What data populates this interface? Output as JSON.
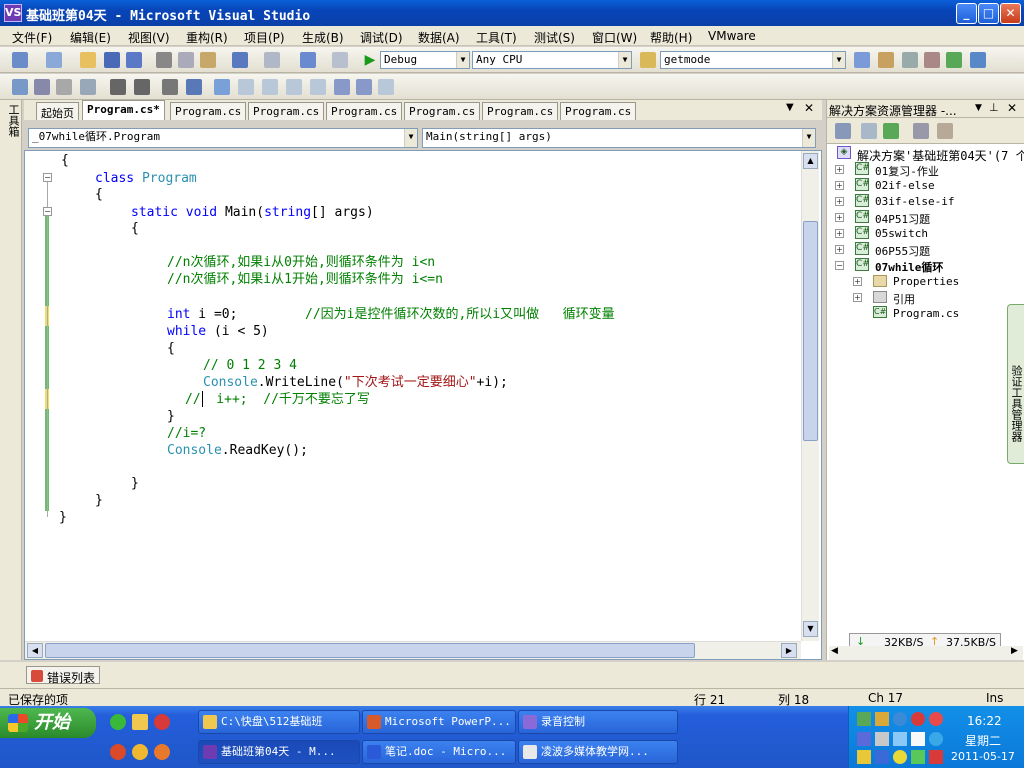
{
  "window": {
    "title": "基础班第04天 - Microsoft Visual Studio",
    "icon_glyph": "VS",
    "buttons": {
      "minimize": "_",
      "maximize": "□",
      "close": "✕"
    }
  },
  "menu": [
    "文件(F)",
    "编辑(E)",
    "视图(V)",
    "重构(R)",
    "项目(P)",
    "生成(B)",
    "调试(D)",
    "数据(A)",
    "工具(T)",
    "测试(S)",
    "窗口(W)",
    "帮助(H)",
    "VMware"
  ],
  "toolbar": {
    "config": "Debug",
    "platform": "Any CPU",
    "find": "getmode"
  },
  "toolbox_label": "工具箱",
  "doc_tabs": [
    {
      "label": "起始页",
      "active": false
    },
    {
      "label": "Program.cs*",
      "active": true
    },
    {
      "label": "Program.cs",
      "active": false
    },
    {
      "label": "Program.cs",
      "active": false
    },
    {
      "label": "Program.cs",
      "active": false
    },
    {
      "label": "Program.cs",
      "active": false
    },
    {
      "label": "Program.cs",
      "active": false
    },
    {
      "label": "Program.cs",
      "active": false
    }
  ],
  "nav": {
    "class_combo": "_07while循环.Program",
    "member_combo": "Main(string[] args)"
  },
  "code": {
    "l1": "{",
    "l2_kw": "class",
    "l2_ty": "Program",
    "l3": "{",
    "l4_kw1": "static",
    "l4_kw2": "void",
    "l4_rest": "Main(",
    "l4_kw3": "string",
    "l4_end": "[] args)",
    "l5": "{",
    "c1": "//n次循环,如果i从0开始,则循环条件为 i<n",
    "c2": "//n次循环,如果i从1开始,则循环条件为 i<=n",
    "l8_kw": "int",
    "l8_rest": " i =0;",
    "l8_cm": "//因为i是控件循环次数的,所以i又叫做   循环变量",
    "l9_kw": "while",
    "l9_rest": " (i < 5)",
    "l10": "{",
    "c3": "// 0 1 2 3 4",
    "l12_ty": "Console",
    "l12_mid": ".WriteLine(",
    "l12_str": "\"下次考试一定要细心\"",
    "l12_end": "+i);",
    "l13_cm1": "//",
    "l13_mid": "  i++;",
    "l13_cm2": "  //千万不要忘了写",
    "l14": "}",
    "c4": "//i=?",
    "l16_ty": "Console",
    "l16_rest": ".ReadKey();",
    "l17": "}",
    "l18": "}",
    "l19": "}"
  },
  "solution": {
    "title": "解决方案资源管理器 -...",
    "root": "解决方案'基础班第04天'(7 个",
    "projects": [
      "01复习-作业",
      "02if-else",
      "03if-else-if",
      "04P51习题",
      "05switch",
      "06P55习题",
      "07while循环"
    ],
    "children": [
      "Properties",
      "引用",
      "Program.cs"
    ],
    "side_tab": "验证工具管理器",
    "net_down": "32KB/S",
    "net_up": "37.5KB/S"
  },
  "error_tab": "错误列表",
  "status": {
    "message": "已保存的项",
    "line": "行 21",
    "col": "列 18",
    "ch": "Ch 17",
    "mode": "Ins"
  },
  "taskbar": {
    "start": "开始",
    "row1": [
      "C:\\快盘\\512基础班",
      "Microsoft PowerP...",
      "录音控制"
    ],
    "row2": [
      "基础班第04天 - M...",
      "笔记.doc - Micro...",
      "凌波多媒体教学网..."
    ],
    "time": "16:22",
    "weekday": "星期二",
    "date": "2011-05-17"
  },
  "colors": {
    "keyword": "#0000ff",
    "type": "#2b91af",
    "comment": "#008000",
    "string": "#a31515"
  }
}
